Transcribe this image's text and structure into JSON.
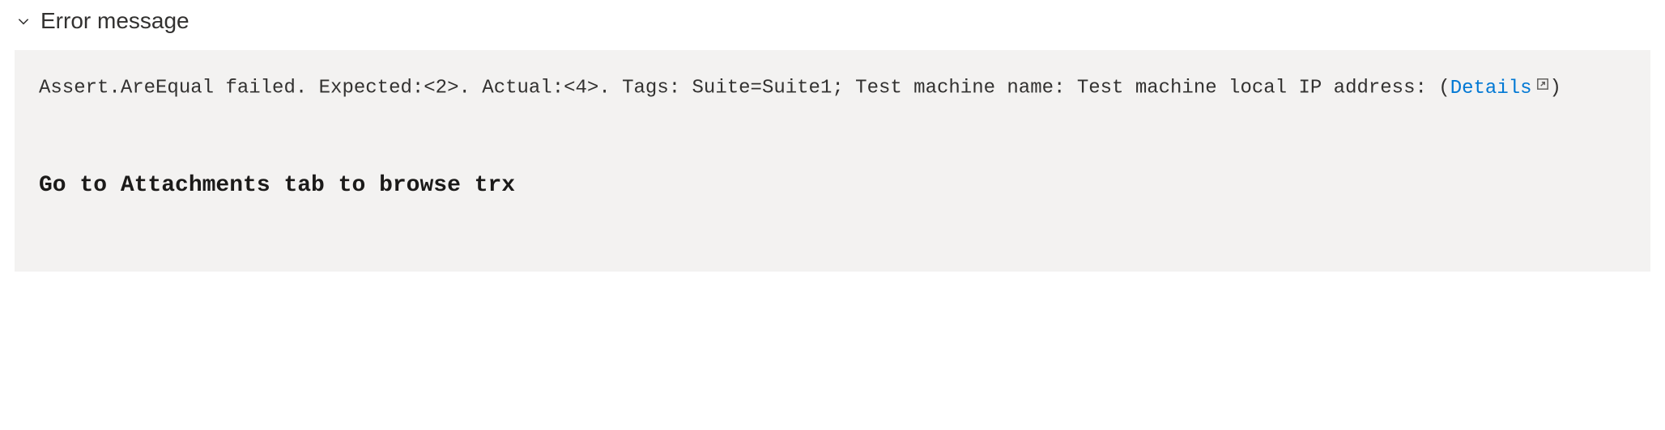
{
  "section": {
    "title": "Error message"
  },
  "message": {
    "line1_prefix": "Assert.AreEqual failed. Expected:<2>. Actual:<4>. Tags: Suite=Suite1; Test machine name:",
    "line2_prefix": "Test machine local IP address:",
    "details_link_label": "Details",
    "attachment_note": "Go to Attachments tab to browse trx"
  }
}
